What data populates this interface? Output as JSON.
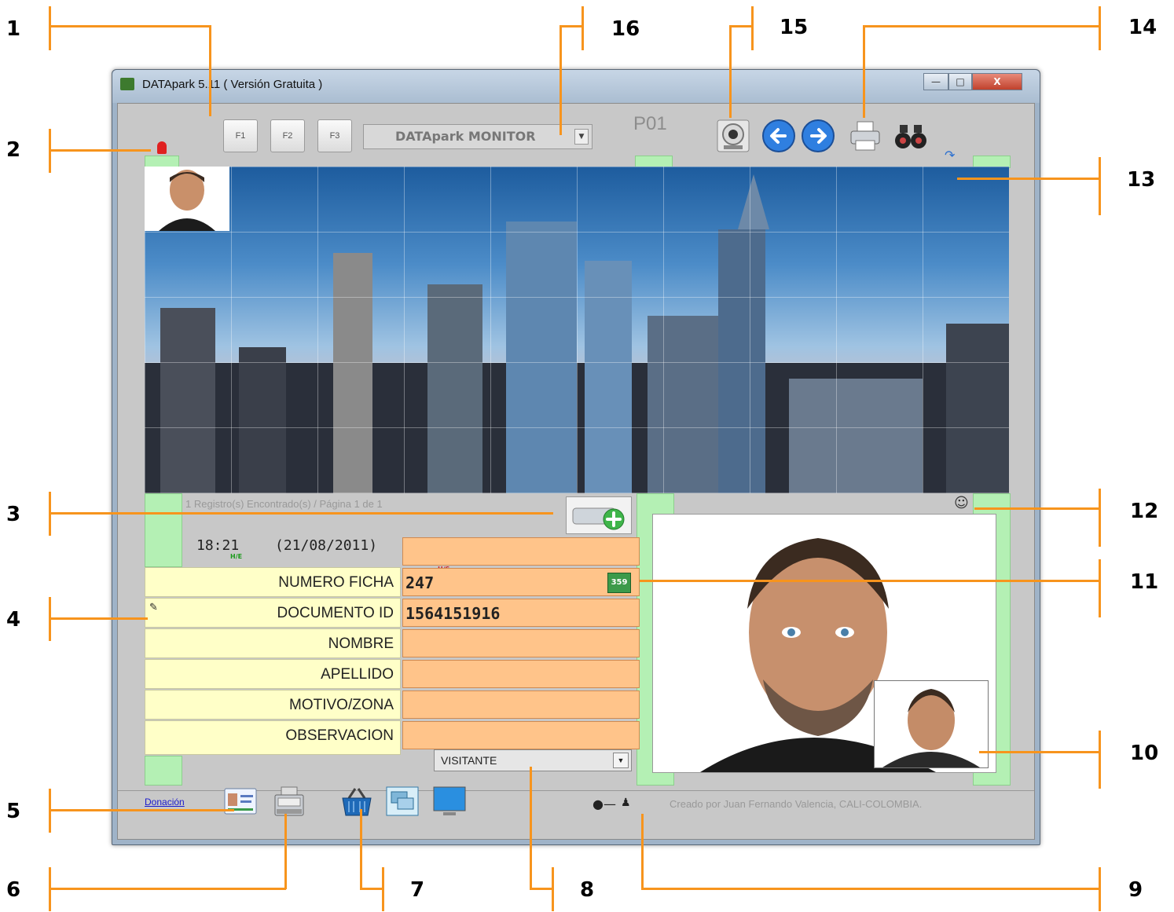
{
  "window": {
    "title": "DATApark 5.11  ( Versión Gratuita )",
    "controls": [
      "minimize",
      "maximize",
      "close"
    ]
  },
  "toolbar": {
    "function_keys": [
      "F1",
      "F2",
      "F3"
    ],
    "monitor_select_value": "DATApark MONITOR",
    "station_id": "P01",
    "buttons": [
      {
        "name": "webcam",
        "icon": "webcam-icon"
      },
      {
        "name": "previous",
        "icon": "arrow-left-icon"
      },
      {
        "name": "next",
        "icon": "arrow-right-icon"
      },
      {
        "name": "print",
        "icon": "printer-icon"
      },
      {
        "name": "search",
        "icon": "binoculars-icon"
      }
    ]
  },
  "record": {
    "status": "1 Registro(s) Encontrado(s) / Página 1 de 1",
    "time": "18:21",
    "date": "(21/08/2011)",
    "entry_tag": "H/E",
    "exit_tag": "H/S",
    "fields": [
      {
        "label": "NUMERO FICHA",
        "value": "247"
      },
      {
        "label": "DOCUMENTO ID",
        "value": "1564151916"
      },
      {
        "label": "NOMBRE",
        "value": ""
      },
      {
        "label": "APELLIDO",
        "value": ""
      },
      {
        "label": "MOTIVO/ZONA",
        "value": ""
      },
      {
        "label": "OBSERVACION",
        "value": ""
      }
    ],
    "visitor_type": "VISITANTE",
    "ficha_badge": "359"
  },
  "footer": {
    "donation_link": "Donación",
    "credits": "Creado por Juan Fernando Valencia, CALI-COLOMBIA."
  },
  "callouts": [
    "1",
    "2",
    "3",
    "4",
    "5",
    "6",
    "7",
    "8",
    "9",
    "10",
    "11",
    "12",
    "13",
    "14",
    "15",
    "16"
  ],
  "colors": {
    "callout_line": "#f7941d",
    "label_bg": "#ffffc8",
    "value_bg": "#ffc48a",
    "green_tab": "#b4f0b4"
  }
}
